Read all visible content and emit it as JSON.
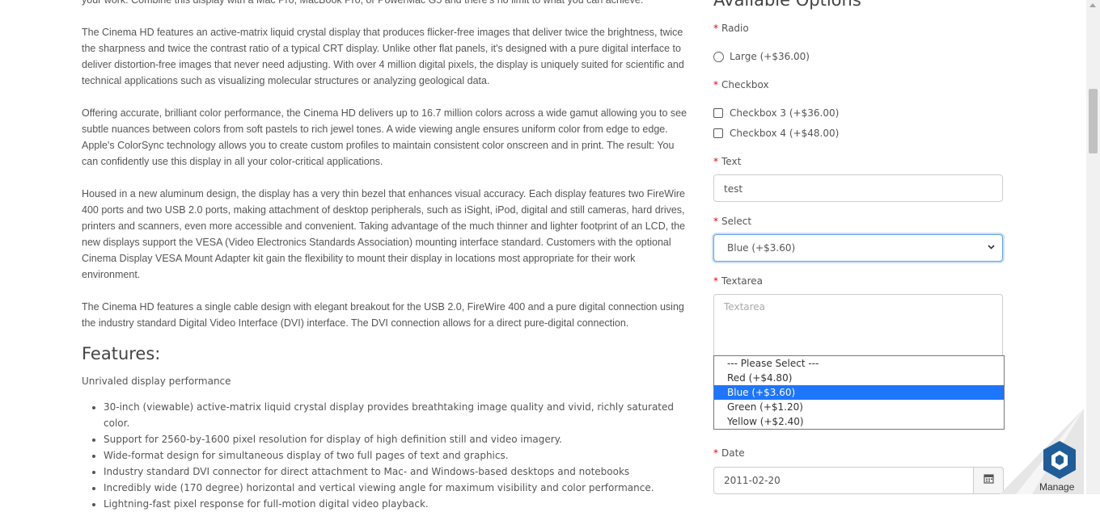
{
  "description": {
    "partial_line": "your work. Combine this display with a Mac Pro, MacBook Pro, or PowerMac G5 and there's no limit to what you can achieve.",
    "p1": "The Cinema HD features an active-matrix liquid crystal display that produces flicker-free images that deliver twice the brightness, twice the sharpness and twice the contrast ratio of a typical CRT display. Unlike other flat panels, it's designed with a pure digital interface to deliver distortion-free images that never need adjusting. With over 4 million digital pixels, the display is uniquely suited for scientific and technical applications such as visualizing molecular structures or analyzing geological data.",
    "p2": "Offering accurate, brilliant color performance, the Cinema HD delivers up to 16.7 million colors across a wide gamut allowing you to see subtle nuances between colors from soft pastels to rich jewel tones. A wide viewing angle ensures uniform color from edge to edge. Apple's ColorSync technology allows you to create custom profiles to maintain consistent color onscreen and in print. The result: You can confidently use this display in all your color-critical applications.",
    "p3": "Housed in a new aluminum design, the display has a very thin bezel that enhances visual accuracy. Each display features two FireWire 400 ports and two USB 2.0 ports, making attachment of desktop peripherals, such as iSight, iPod, digital and still cameras, hard drives, printers and scanners, even more accessible and convenient. Taking advantage of the much thinner and lighter footprint of an LCD, the new displays support the VESA (Video Electronics Standards Association) mounting interface standard. Customers with the optional Cinema Display VESA Mount Adapter kit gain the flexibility to mount their display in locations most appropriate for their work environment.",
    "p4": "The Cinema HD features a single cable design with elegant breakout for the USB 2.0, FireWire 400 and a pure digital connection using the industry standard Digital Video Interface (DVI) interface. The DVI connection allows for a direct pure-digital connection."
  },
  "features": {
    "title": "Features:",
    "subtitle": "Unrivaled display performance",
    "items": [
      "30-inch (viewable) active-matrix liquid crystal display provides breathtaking image quality and vivid, richly saturated color.",
      "Support for 2560-by-1600 pixel resolution for display of high definition still and video imagery.",
      "Wide-format design for simultaneous display of two full pages of text and graphics.",
      "Industry standard DVI connector for direct attachment to Mac- and Windows-based desktops and notebooks",
      "Incredibly wide (170 degree) horizontal and vertical viewing angle for maximum visibility and color performance.",
      "Lightning-fast pixel response for full-motion digital video playback."
    ]
  },
  "options": {
    "title": "Available Options",
    "required_mark": "*",
    "radio": {
      "label": "Radio",
      "option": "Large (+$36.00)"
    },
    "checkbox": {
      "label": "Checkbox",
      "options": [
        "Checkbox 3 (+$36.00)",
        "Checkbox 4 (+$48.00)"
      ]
    },
    "text": {
      "label": "Text",
      "value": "test"
    },
    "select": {
      "label": "Select",
      "value": "Blue (+$3.60)",
      "options": [
        "--- Please Select ---",
        "Red (+$4.80)",
        "Blue (+$3.60)",
        "Green (+$1.20)",
        "Yellow (+$2.40)"
      ]
    },
    "textarea": {
      "label": "Textarea",
      "placeholder": "Textarea"
    },
    "date": {
      "label": "Date",
      "value": "2011-02-20"
    }
  },
  "widget": {
    "label": "Manage"
  },
  "colors": {
    "accent": "#1e75ff",
    "required": "#e00000",
    "focus": "#66a3e6"
  }
}
